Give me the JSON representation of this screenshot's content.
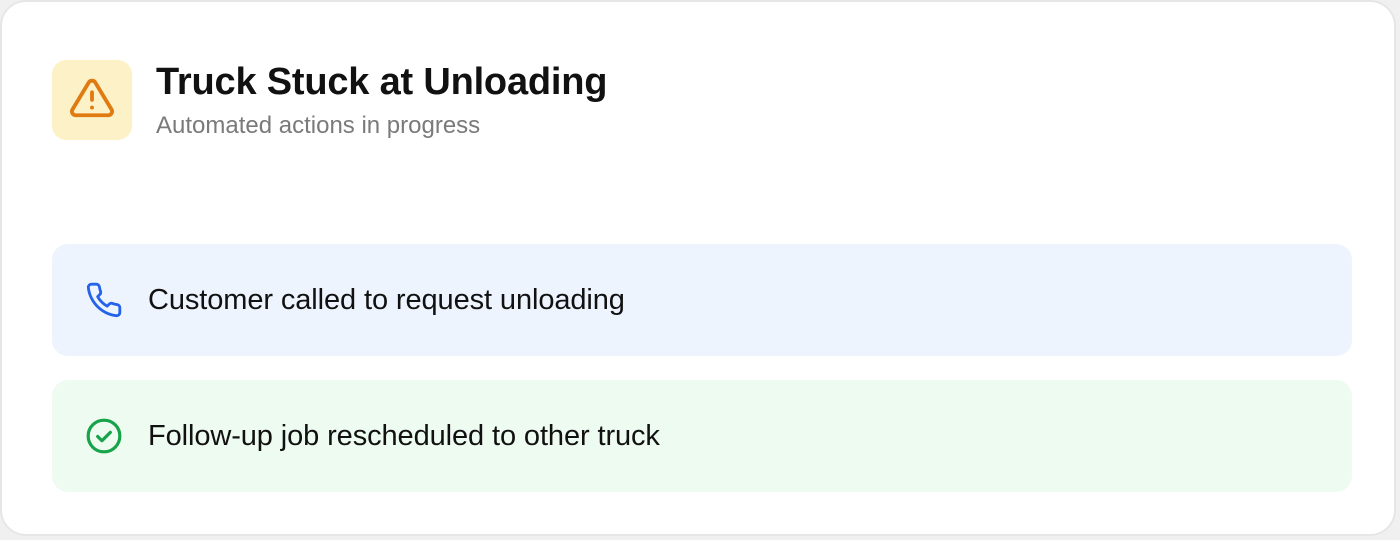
{
  "alert": {
    "title": "Truck Stuck at Unloading",
    "subtitle": "Automated actions in progress",
    "icon": "warning-triangle-icon",
    "colors": {
      "tile_background": "#fdf2c7",
      "icon": "#e07b12"
    }
  },
  "actions": [
    {
      "label": "Customer called to request unloading",
      "icon": "phone-icon",
      "status": "info",
      "colors": {
        "background": "#edf4fe",
        "icon": "#2563eb"
      }
    },
    {
      "label": "Follow-up job rescheduled to other truck",
      "icon": "check-circle-icon",
      "status": "success",
      "colors": {
        "background": "#eefbf1",
        "icon": "#16a34a"
      }
    }
  ]
}
